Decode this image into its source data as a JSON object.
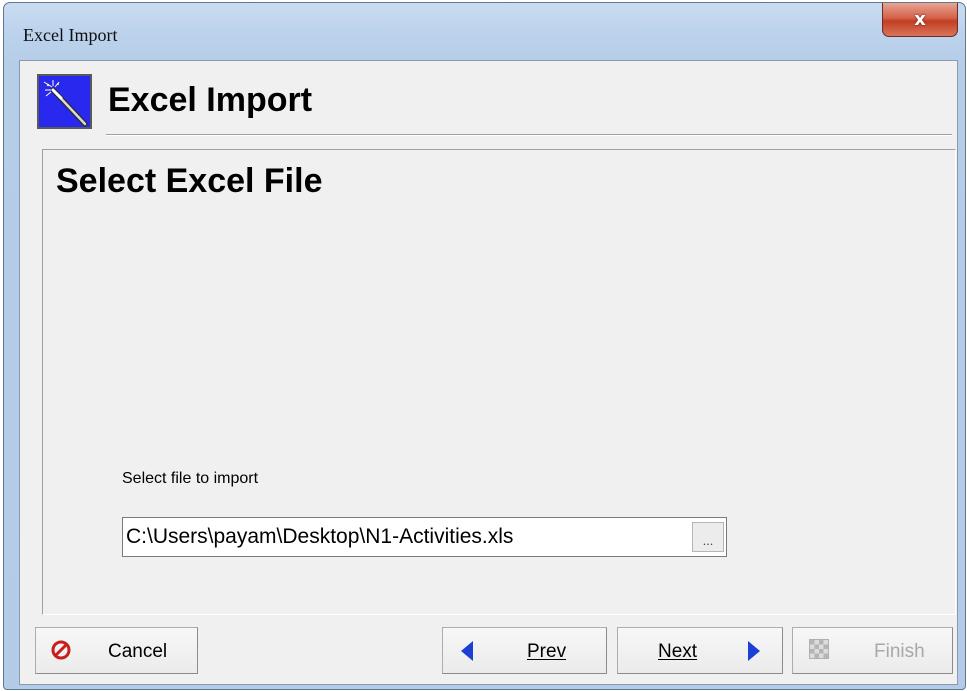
{
  "window": {
    "title": "Excel Import",
    "close_glyph": "x"
  },
  "header": {
    "title": "Excel Import",
    "icon": "magic-wand-icon"
  },
  "step": {
    "title": "Select Excel File",
    "file_label": "Select file to import",
    "file_path": "C:\\Users\\payam\\Desktop\\N1-Activities.xls",
    "browse_label": "..."
  },
  "buttons": {
    "cancel": {
      "label": "Cancel",
      "icon": "stop-icon"
    },
    "prev": {
      "label": "Prev",
      "icon": "arrow-left-icon"
    },
    "next": {
      "label": "Next",
      "icon": "arrow-right-icon"
    },
    "finish": {
      "label": "Finish",
      "icon": "checkered-flag-icon",
      "enabled": false
    }
  },
  "colors": {
    "accent_blue": "#2828ee",
    "arrow_blue": "#1c3fd6",
    "cancel_red": "#c81e1e",
    "disabled_text": "#a8a8a8"
  }
}
